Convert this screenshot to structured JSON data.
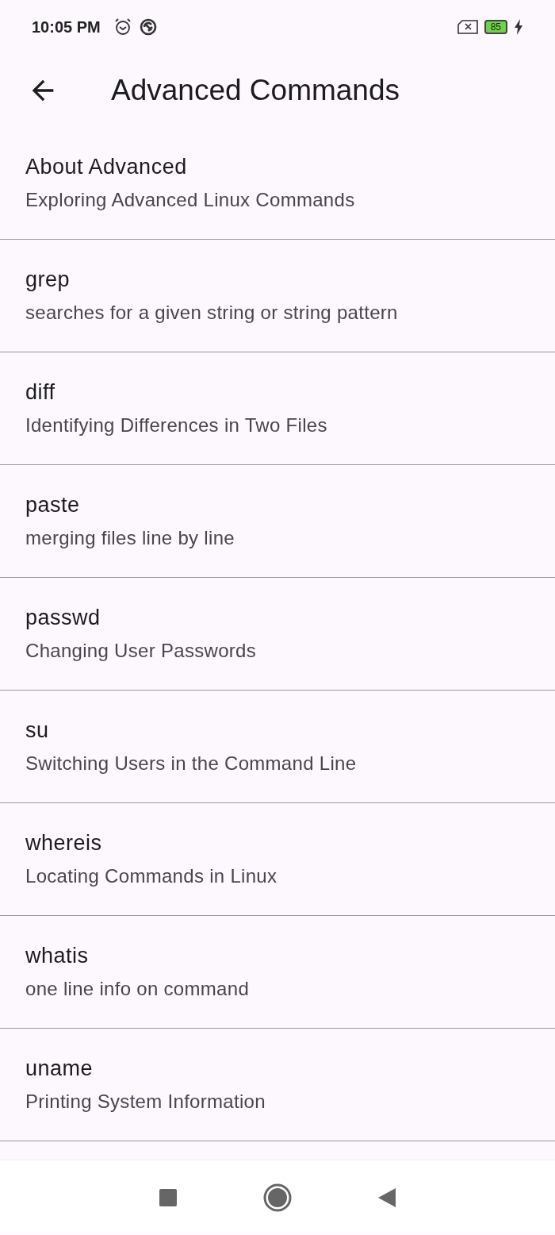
{
  "status_bar": {
    "time": "10:05 PM",
    "battery": "85"
  },
  "app_bar": {
    "title": "Advanced Commands"
  },
  "items": [
    {
      "title": "About Advanced",
      "subtitle": "Exploring Advanced Linux Commands"
    },
    {
      "title": "grep",
      "subtitle": "searches for a given string or string pattern"
    },
    {
      "title": "diff",
      "subtitle": "Identifying Differences in Two Files"
    },
    {
      "title": "paste",
      "subtitle": "merging files line by line"
    },
    {
      "title": "passwd",
      "subtitle": "Changing User Passwords"
    },
    {
      "title": "su",
      "subtitle": "Switching Users in the Command Line"
    },
    {
      "title": "whereis",
      "subtitle": "Locating Commands in Linux"
    },
    {
      "title": "whatis",
      "subtitle": "one line info on command"
    },
    {
      "title": "uname",
      "subtitle": "Printing System Information"
    }
  ]
}
